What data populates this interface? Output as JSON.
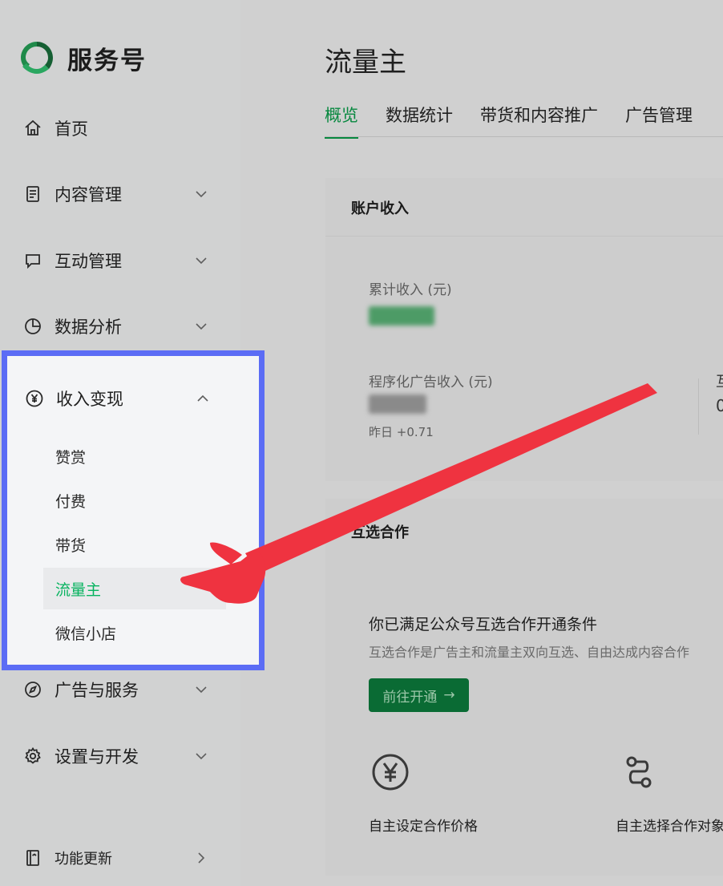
{
  "brand": {
    "name": "服务号",
    "color": "#07b35f"
  },
  "sidebar": {
    "items": [
      {
        "label": "首页",
        "icon": "home-icon"
      },
      {
        "label": "内容管理",
        "icon": "document-icon"
      },
      {
        "label": "互动管理",
        "icon": "chat-bubble-icon"
      },
      {
        "label": "数据分析",
        "icon": "pie-chart-icon"
      },
      {
        "label": "收入变现",
        "icon": "yen-icon"
      },
      {
        "label": "广告与服务",
        "icon": "compass-icon"
      },
      {
        "label": "设置与开发",
        "icon": "gear-icon"
      },
      {
        "label": "功能更新",
        "icon": "book-icon"
      }
    ],
    "sub_items": [
      "赞赏",
      "付费",
      "带货",
      "流量主",
      "微信小店"
    ],
    "active_sub_item": "流量主"
  },
  "main": {
    "title": "流量主",
    "tabs": [
      "概览",
      "数据统计",
      "带货和内容推广",
      "广告管理"
    ],
    "active_tab": "概览",
    "account_card": {
      "title": "账户收入",
      "total_income_label": "累计收入 (元)",
      "programmatic_label": "程序化广告收入 (元)",
      "yesterday_label": "昨日 +0.71",
      "partial_right_label": "互",
      "partial_right_value": "0"
    },
    "mutual_card": {
      "title_partial": "互选合作",
      "heading": "你已满足公众号互选合作开通条件",
      "description": "互选合作是广告主和流量主双向互选、自由达成内容合作",
      "button_label": "前往开通",
      "button_arrow": "→",
      "features": [
        {
          "label": "自主设定合作价格",
          "icon": "yen-circle-icon"
        },
        {
          "label": "自主选择合作对象",
          "icon": "route-icon"
        }
      ]
    }
  },
  "colors": {
    "highlight_border": "#5b6cf5",
    "annotation_arrow": "#ef3340",
    "active_green": "#07b35f",
    "button_green": "#0a6b34"
  }
}
